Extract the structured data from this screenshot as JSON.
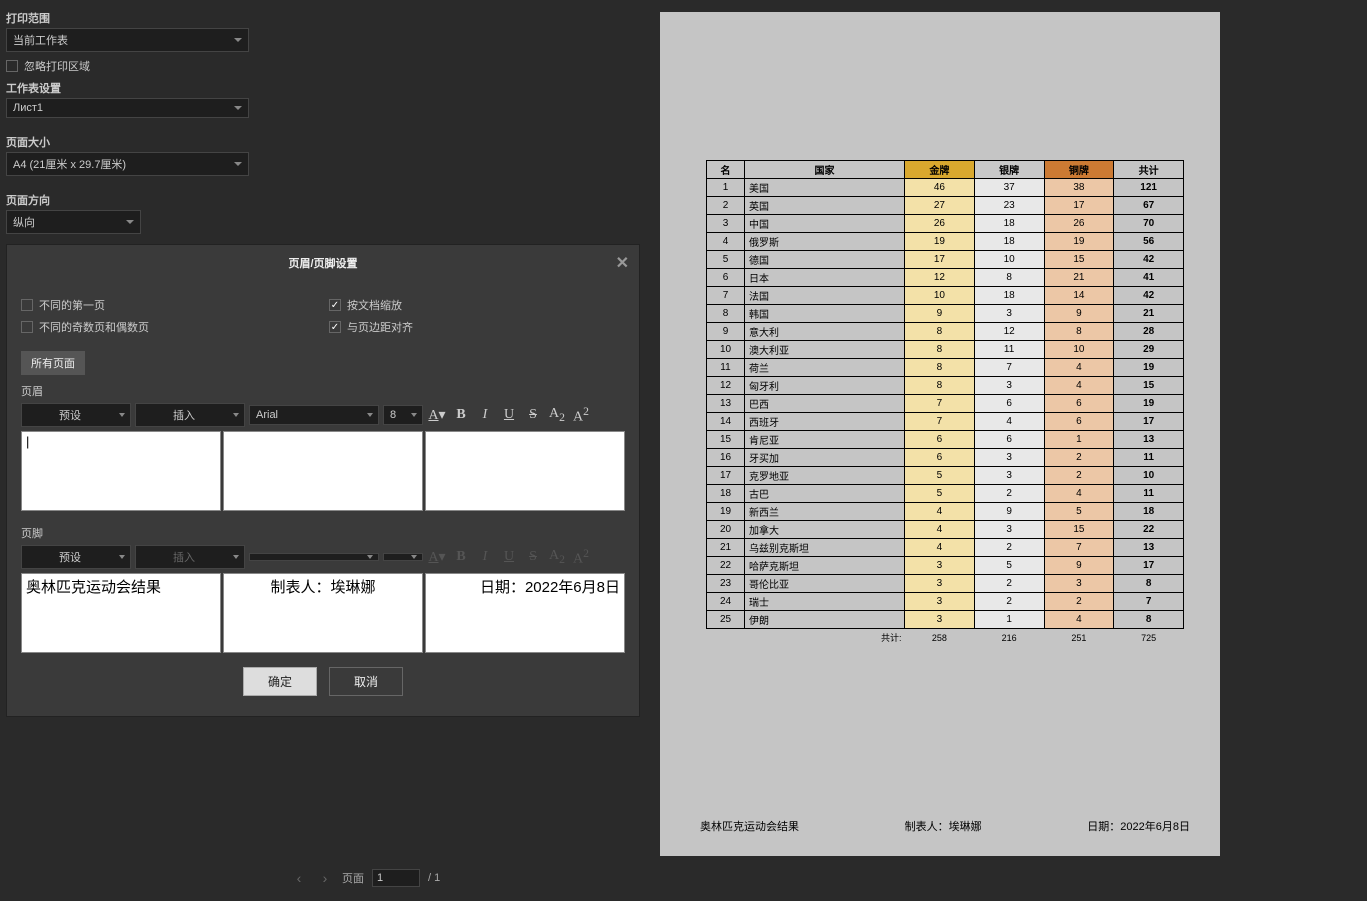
{
  "sidebar": {
    "print_range_label": "打印范围",
    "print_range_value": "当前工作表",
    "ignore_print_area": "忽略打印区域",
    "sheet_settings_label": "工作表设置",
    "sheet_value": "Лист1",
    "page_size_label": "页面大小",
    "page_size_value": "A4 (21厘米 x 29.7厘米)",
    "orientation_label": "页面方向",
    "orientation_value": "纵向"
  },
  "dialog": {
    "title": "页眉/页脚设置",
    "diff_first": "不同的第一页",
    "diff_odd_even": "不同的奇数页和偶数页",
    "scale_with_doc": "按文档缩放",
    "align_margins": "与页边距对齐",
    "all_pages_tab": "所有页面",
    "header_label": "页眉",
    "footer_label": "页脚",
    "preset": "预设",
    "insert": "插入",
    "font": "Arial",
    "font_size": "8",
    "ok": "确定",
    "cancel": "取消",
    "footer_left": "奥林匹克运动会结果",
    "footer_center": "制表人：埃琳娜",
    "footer_right": "日期：2022年6月8日"
  },
  "pager": {
    "label": "页面",
    "current": "1",
    "total": "/ 1"
  },
  "chart_data": {
    "type": "table",
    "headers": {
      "rank": "名",
      "country": "国家",
      "gold": "金牌",
      "silver": "银牌",
      "bronze": "铜牌",
      "total": "共计"
    },
    "rows": [
      {
        "rank": 1,
        "country": "美国",
        "gold": 46,
        "silver": 37,
        "bronze": 38,
        "total": 121
      },
      {
        "rank": 2,
        "country": "英国",
        "gold": 27,
        "silver": 23,
        "bronze": 17,
        "total": 67
      },
      {
        "rank": 3,
        "country": "中国",
        "gold": 26,
        "silver": 18,
        "bronze": 26,
        "total": 70
      },
      {
        "rank": 4,
        "country": "俄罗斯",
        "gold": 19,
        "silver": 18,
        "bronze": 19,
        "total": 56
      },
      {
        "rank": 5,
        "country": "德国",
        "gold": 17,
        "silver": 10,
        "bronze": 15,
        "total": 42
      },
      {
        "rank": 6,
        "country": "日本",
        "gold": 12,
        "silver": 8,
        "bronze": 21,
        "total": 41
      },
      {
        "rank": 7,
        "country": "法国",
        "gold": 10,
        "silver": 18,
        "bronze": 14,
        "total": 42
      },
      {
        "rank": 8,
        "country": "韩国",
        "gold": 9,
        "silver": 3,
        "bronze": 9,
        "total": 21
      },
      {
        "rank": 9,
        "country": "意大利",
        "gold": 8,
        "silver": 12,
        "bronze": 8,
        "total": 28
      },
      {
        "rank": 10,
        "country": "澳大利亚",
        "gold": 8,
        "silver": 11,
        "bronze": 10,
        "total": 29
      },
      {
        "rank": 11,
        "country": "荷兰",
        "gold": 8,
        "silver": 7,
        "bronze": 4,
        "total": 19
      },
      {
        "rank": 12,
        "country": "匈牙利",
        "gold": 8,
        "silver": 3,
        "bronze": 4,
        "total": 15
      },
      {
        "rank": 13,
        "country": "巴西",
        "gold": 7,
        "silver": 6,
        "bronze": 6,
        "total": 19
      },
      {
        "rank": 14,
        "country": "西班牙",
        "gold": 7,
        "silver": 4,
        "bronze": 6,
        "total": 17
      },
      {
        "rank": 15,
        "country": "肯尼亚",
        "gold": 6,
        "silver": 6,
        "bronze": 1,
        "total": 13
      },
      {
        "rank": 16,
        "country": "牙买加",
        "gold": 6,
        "silver": 3,
        "bronze": 2,
        "total": 11
      },
      {
        "rank": 17,
        "country": "克罗地亚",
        "gold": 5,
        "silver": 3,
        "bronze": 2,
        "total": 10
      },
      {
        "rank": 18,
        "country": "古巴",
        "gold": 5,
        "silver": 2,
        "bronze": 4,
        "total": 11
      },
      {
        "rank": 19,
        "country": "新西兰",
        "gold": 4,
        "silver": 9,
        "bronze": 5,
        "total": 18
      },
      {
        "rank": 20,
        "country": "加拿大",
        "gold": 4,
        "silver": 3,
        "bronze": 15,
        "total": 22
      },
      {
        "rank": 21,
        "country": "乌兹别克斯坦",
        "gold": 4,
        "silver": 2,
        "bronze": 7,
        "total": 13
      },
      {
        "rank": 22,
        "country": "哈萨克斯坦",
        "gold": 3,
        "silver": 5,
        "bronze": 9,
        "total": 17
      },
      {
        "rank": 23,
        "country": "哥伦比亚",
        "gold": 3,
        "silver": 2,
        "bronze": 3,
        "total": 8
      },
      {
        "rank": 24,
        "country": "瑞士",
        "gold": 3,
        "silver": 2,
        "bronze": 2,
        "total": 7
      },
      {
        "rank": 25,
        "country": "伊朗",
        "gold": 3,
        "silver": 1,
        "bronze": 4,
        "total": 8
      }
    ],
    "totals": {
      "label": "共计:",
      "gold": 258,
      "silver": 216,
      "bronze": 251,
      "total": 725
    },
    "footer": {
      "left": "奥林匹克运动会结果",
      "center": "制表人：埃琳娜",
      "right": "日期：2022年6月8日"
    }
  }
}
